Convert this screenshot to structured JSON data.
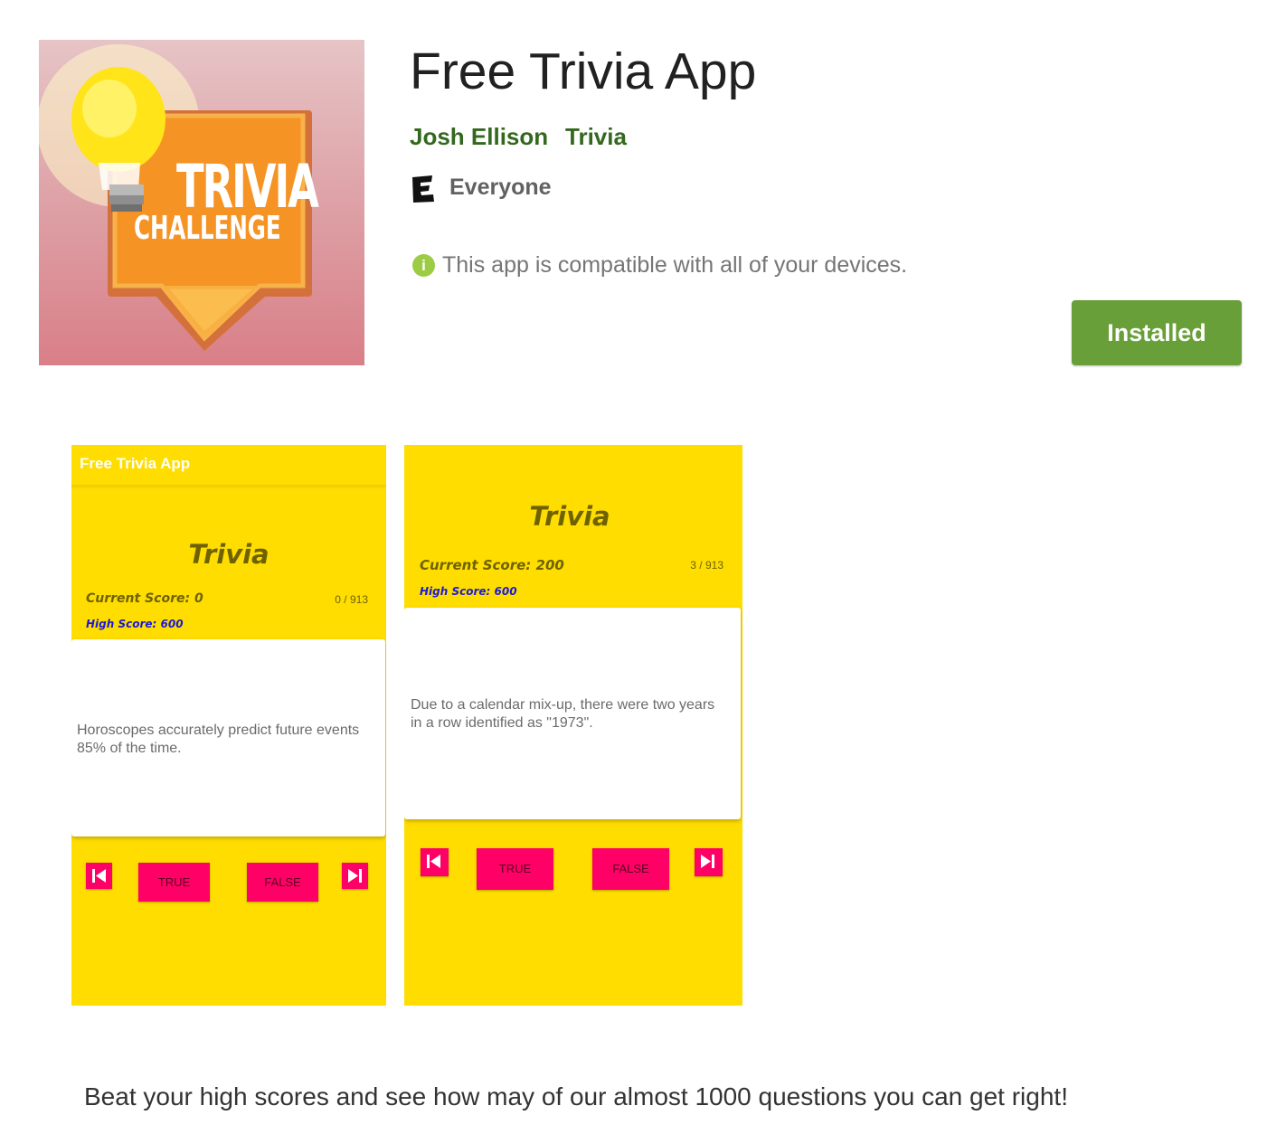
{
  "app": {
    "title": "Free Trivia App",
    "developer": "Josh Ellison",
    "category": "Trivia",
    "content_rating": "Everyone",
    "rating_icon": "E",
    "compat_icon": "i",
    "compatibility": "This app is compatible with all of your devices.",
    "install_label": "Installed",
    "description": "Beat your high scores and see how may of our almost 1000 questions you can get right!"
  },
  "icon": {
    "line1": "TRIVIA",
    "line2": "CHALLENGE"
  },
  "screenshots": [
    {
      "toolbar_title": "Free Trivia App",
      "game_title": "Trivia",
      "current_score": "Current Score: 0",
      "count": "0 / 913",
      "high_score": "High Score: 600",
      "question": "Horoscopes accurately predict future events 85% of the time.",
      "true_label": "TRUE",
      "false_label": "FALSE"
    },
    {
      "game_title": "Trivia",
      "current_score": "Current Score: 200",
      "count": "3 / 913",
      "high_score": "High Score: 600",
      "question": "Due to a calendar mix-up, there were two years in a row identified as \"1973\".",
      "true_label": "TRUE",
      "false_label": "FALSE"
    }
  ],
  "colors": {
    "accent_green": "#33691e",
    "install_green": "#689f38",
    "screenshot_yellow": "#ffdd00",
    "button_pink": "#ff0066"
  }
}
